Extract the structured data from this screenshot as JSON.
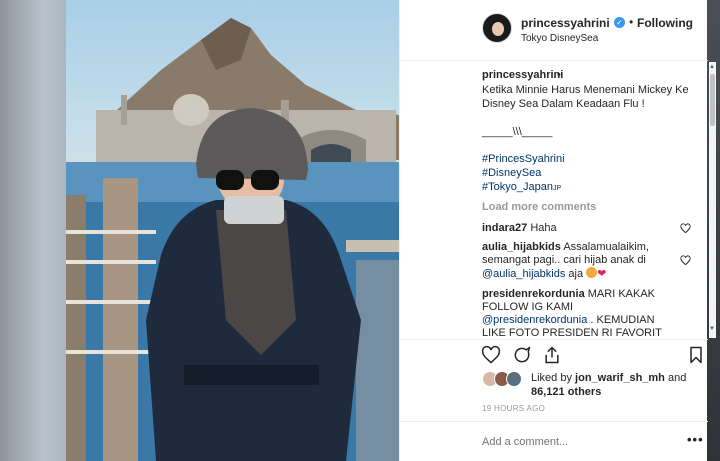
{
  "post": {
    "username": "princessyahrini",
    "follow_separator": "•",
    "follow_status": "Following",
    "location": "Tokyo DisneySea",
    "verified_mark": "✓"
  },
  "caption": {
    "username": "princessyahrini",
    "separator": "•",
    "line1": "Ketika Minnie Harus Menemani Mickey Ke",
    "line2": "Disney Sea Dalam Keadaan Flu !",
    "line3": "_____\\\\\\_____",
    "hashtags": [
      "#PrincesSyahrini",
      "#DisneySea",
      "#Tokyo_Japan"
    ],
    "flag": "JP"
  },
  "load_more": "Load more comments",
  "comments": [
    {
      "user": "indara27",
      "lines": [
        "Haha"
      ]
    },
    {
      "user": "aulia_hijabkids",
      "lines": [
        "Assalamualaikim,",
        "semangat pagi.. cari hijab anak di"
      ],
      "mention": "@aulia_hijabkids",
      "tail": "aja"
    },
    {
      "user": "presidenrekordunia",
      "lines": [
        "MARI KAKAK",
        "FOLLOW IG KAMI"
      ],
      "mention": "@presidenrekordunia",
      "tail": ". KEMUDIAN",
      "cut_line": "LIKE FOTO PRESIDEN RI FAVORIT"
    }
  ],
  "likes": {
    "prefix": "Liked by",
    "user": "jon_warif_sh_mh",
    "joiner": "and",
    "others": "86,121 others"
  },
  "timestamp": "19 HOURS AGO",
  "add_comment_placeholder": "Add a comment...",
  "more_options": "•••",
  "icons": {
    "like": "heart-icon",
    "comment": "comment-icon",
    "share": "share-icon",
    "save": "bookmark-icon",
    "verified": "verified-badge-icon"
  },
  "colors": {
    "link": "#003569",
    "verified": "#3897f0",
    "muted": "#999999",
    "text": "#262626"
  }
}
